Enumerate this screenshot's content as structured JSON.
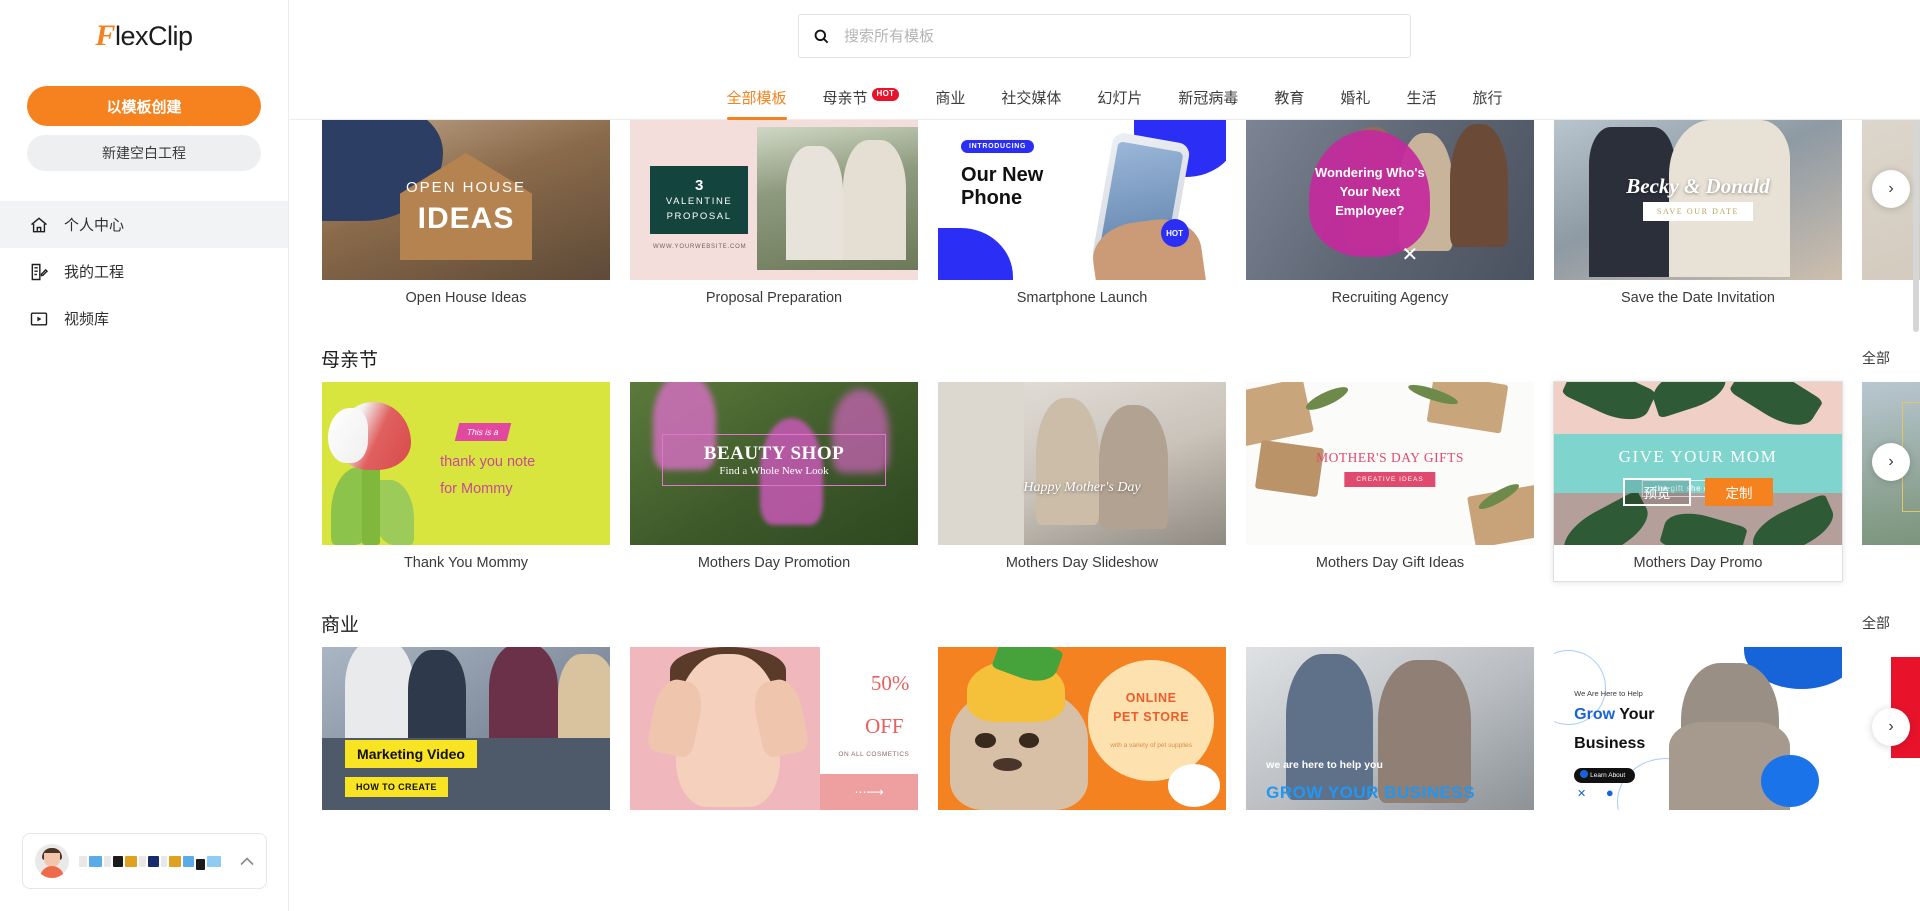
{
  "brand": {
    "name_f": "F",
    "name_rest": "lexClip",
    "accent": "#F5821F"
  },
  "sidebar": {
    "create_from_template": "以模板创建",
    "create_blank": "新建空白工程",
    "items": [
      {
        "label": "个人中心",
        "icon": "home-icon",
        "active": true
      },
      {
        "label": "我的工程",
        "icon": "projects-icon",
        "active": false
      },
      {
        "label": "视频库",
        "icon": "video-library-icon",
        "active": false
      }
    ],
    "user": {
      "name_redacted": "████ ████ ███",
      "chevron": "⌃"
    }
  },
  "search": {
    "placeholder": "搜索所有模板",
    "value": "",
    "icon": "search-icon"
  },
  "tabs": [
    {
      "label": "全部模板",
      "active": true,
      "badge": ""
    },
    {
      "label": "母亲节",
      "active": false,
      "badge": "HOT"
    },
    {
      "label": "商业",
      "active": false,
      "badge": ""
    },
    {
      "label": "社交媒体",
      "active": false,
      "badge": ""
    },
    {
      "label": "幻灯片",
      "active": false,
      "badge": ""
    },
    {
      "label": "新冠病毒",
      "active": false,
      "badge": ""
    },
    {
      "label": "教育",
      "active": false,
      "badge": ""
    },
    {
      "label": "婚礼",
      "active": false,
      "badge": ""
    },
    {
      "label": "生活",
      "active": false,
      "badge": ""
    },
    {
      "label": "旅行",
      "active": false,
      "badge": ""
    }
  ],
  "hover_actions": {
    "preview": "预览",
    "customize": "定制"
  },
  "see_all_label": "全部",
  "next_arrow": "›",
  "sections": [
    {
      "title": "",
      "see_all": "",
      "cards": [
        {
          "caption": "Open House Ideas",
          "art": {
            "line1": "OPEN HOUSE",
            "line2": "IDEAS"
          }
        },
        {
          "caption": "Proposal Preparation",
          "art": {
            "num": "3",
            "line1": "VALENTINE",
            "line2": "PROPOSAL",
            "url": "WWW.YOURWEBSITE.COM"
          }
        },
        {
          "caption": "Smartphone Launch",
          "art": {
            "pill": "INTRODUCING",
            "line1": "Our New",
            "line2": "Phone",
            "badge": "HOT"
          }
        },
        {
          "caption": "Recruiting Agency",
          "art": {
            "line1": "Wondering Who's Your Next Employee?"
          }
        },
        {
          "caption": "Save the Date Invitation",
          "art": {
            "line1": "Becky & Donald",
            "tag": "SAVE OUR DATE"
          }
        }
      ]
    },
    {
      "title": "母亲节",
      "see_all": "全部",
      "cards": [
        {
          "caption": "Thank You Mommy",
          "art": {
            "badge": "This is a",
            "line1": "thank you note",
            "line2": "for Mommy"
          }
        },
        {
          "caption": "Mothers Day Promotion",
          "art": {
            "line1": "BEAUTY SHOP",
            "line2": "Find a Whole New Look"
          }
        },
        {
          "caption": "Mothers Day Slideshow",
          "art": {
            "line1": "Happy Mother's Day"
          }
        },
        {
          "caption": "Mothers Day Gift Ideas",
          "art": {
            "line1": "MOTHER'S DAY GIFTS",
            "tag": "CREATIVE IDEAS"
          }
        },
        {
          "caption": "Mothers Day Promo",
          "hovered": true,
          "art": {
            "line1": "GIVE YOUR MOM",
            "line2": "the gift she deserves"
          }
        }
      ]
    },
    {
      "title": "商业",
      "see_all": "全部",
      "cards": [
        {
          "caption": "",
          "art": {
            "line1": "Marketing Video",
            "line2": "HOW TO CREATE"
          }
        },
        {
          "caption": "",
          "art": {
            "line1": "50%",
            "line2": "OFF",
            "line3": "ON ALL COSMETICS"
          }
        },
        {
          "caption": "",
          "art": {
            "line1": "ONLINE",
            "line2": "PET STORE",
            "line3": "with a variety of pet supplies"
          }
        },
        {
          "caption": "",
          "art": {
            "line1": "we are here to help you",
            "line2": "GROW YOUR BUSINESS"
          }
        },
        {
          "caption": "",
          "art": {
            "line1": "We Are Here to Help",
            "line2a": "Grow",
            "line2b": " Your",
            "line3": "Business",
            "pill": "Learn About"
          }
        }
      ]
    }
  ]
}
